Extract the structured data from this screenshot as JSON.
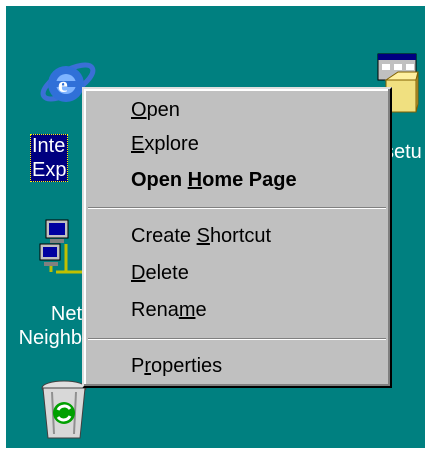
{
  "desktop": {
    "background": "#008080",
    "icons": {
      "internet_explorer": {
        "label_line1": "Inte",
        "label_line2": "Exp"
      },
      "network_neighborhood": {
        "label_line1": "Net",
        "label_line2": "Neighb"
      },
      "setup": {
        "label": "setu"
      },
      "recycle_bin": {}
    }
  },
  "context_menu": {
    "items": [
      {
        "label": "Open",
        "mnemonic_index": 0
      },
      {
        "label": "Explore",
        "mnemonic_index": 0
      },
      {
        "label": "Open Home Page",
        "mnemonic_index": 5,
        "default": true
      },
      {
        "label": "Create Shortcut",
        "mnemonic_index": 7
      },
      {
        "label": "Delete",
        "mnemonic_index": 0
      },
      {
        "label": "Rename",
        "mnemonic_index": 4
      },
      {
        "label": "Properties",
        "mnemonic_index": 1
      }
    ]
  }
}
